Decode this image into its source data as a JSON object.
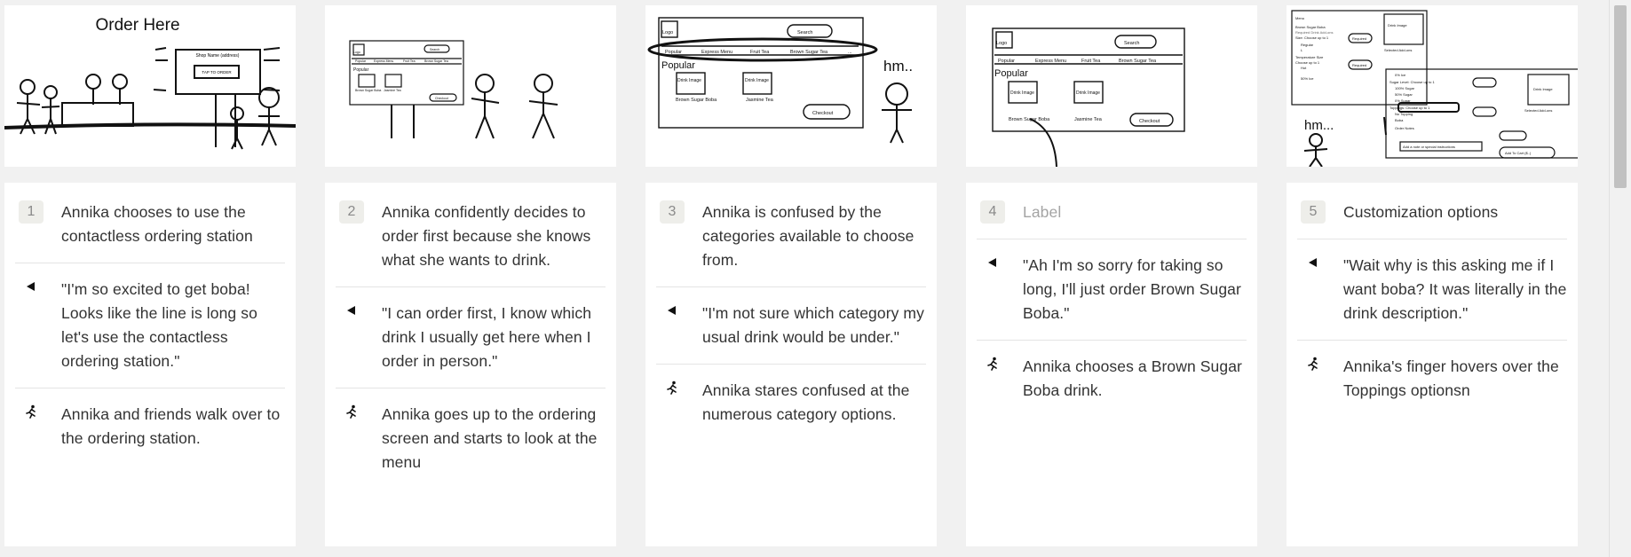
{
  "frames": [
    {
      "sketch_text": "Order Here",
      "mini_text": [
        "Shop Name (address)",
        "TAP TO ORDER"
      ]
    },
    {
      "mini_text": [
        "Logo",
        "Search",
        "Popular",
        "Express Menu",
        "Fruit Tea",
        "Brown Sugar Tea",
        "Popular",
        "Brown Sugar Boba",
        "Jasmine Tea",
        "Checkout"
      ]
    },
    {
      "mini_text": [
        "Logo",
        "Search",
        "Popular",
        "Express Menu",
        "Fruit Tea",
        "Brown Sugar Tea",
        "...",
        "Popular",
        "Drink Image",
        "Drink Image",
        "Brown Sugar Boba",
        "Jasmine Tea",
        "Checkout"
      ],
      "sketch_text": "hm.."
    },
    {
      "mini_text": [
        "Logo",
        "Search",
        "Popular",
        "Express Menu",
        "Fruit Tea",
        "Brown Sugar Tea",
        "Popular",
        "Drink Image",
        "Drink Image",
        "Brown Sugar Boba",
        "Jasmine Tea",
        "Checkout"
      ]
    },
    {
      "mini_text": [
        "Menu",
        "Brown Sugar Boba",
        "Required Drink Add-ons",
        "Size: Choose up to 1",
        "Regular",
        "L",
        "Temperature Size",
        "Choose up to 1",
        "Hot",
        "50% Ice",
        "Drink Image",
        "Required",
        "Required",
        "Selected Add-ons",
        "0% Ice",
        "Sugar Level: Choose up to 1",
        "100% Sugar",
        "50% Sugar",
        "0% Sugar",
        "Toppings: Choose up to 1",
        "No Topping",
        "Boba",
        "Order Notes",
        "Add a note or special instructions",
        "Drink Image",
        "Selected Add-ons",
        "Add To Cart ($..)"
      ],
      "sketch_text": "hm..."
    }
  ],
  "cards": [
    {
      "number": "1",
      "title": "Annika chooses to use the contactless ordering station",
      "dialogue": "\"I'm so excited to get boba! Looks like the line is long so let's use the contactless ordering station.\"",
      "action": "Annika and friends walk over to the ordering station."
    },
    {
      "number": "2",
      "title": "Annika confidently decides to order first because she knows what she wants to drink.",
      "dialogue": "\"I can order first, I know which drink I usually get here when I order in person.\"",
      "action": "Annika goes up to the ordering screen and starts to look at the menu"
    },
    {
      "number": "3",
      "title": "Annika is confused by the categories available to choose from.",
      "dialogue": "\"I'm not sure which category my usual drink would be under.\"",
      "action": "Annika stares confused at the numerous category options."
    },
    {
      "number": "4",
      "title": "Label",
      "dialogue": "\"Ah I'm so sorry for taking so long, I'll just order Brown Sugar Boba.\"",
      "action": "Annika chooses a Brown Sugar Boba drink."
    },
    {
      "number": "5",
      "title": "Customization options",
      "dialogue": "\"Wait why is this asking me if I want boba? It was literally in the drink description.\"",
      "action": "Annika's finger hovers over the Toppings optionsn"
    }
  ]
}
